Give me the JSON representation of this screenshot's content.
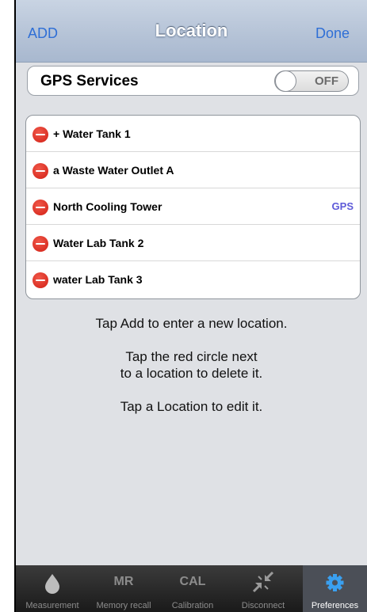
{
  "nav": {
    "left": "ADD",
    "title": "Location",
    "right": "Done"
  },
  "gps": {
    "label": "GPS Services",
    "toggle": "OFF"
  },
  "locations": [
    {
      "name": "+ Water Tank 1",
      "badge": ""
    },
    {
      "name": "a Waste Water Outlet A",
      "badge": ""
    },
    {
      "name": "North Cooling Tower",
      "badge": "GPS"
    },
    {
      "name": "Water Lab Tank 2",
      "badge": ""
    },
    {
      "name": "water Lab Tank 3",
      "badge": ""
    }
  ],
  "instructions": {
    "line1": "Tap Add to enter a new location.",
    "line2a": "Tap the red circle next",
    "line2b": "to a location to delete it.",
    "line3": "Tap a Location to edit it."
  },
  "tabs": [
    {
      "label": "Measurement",
      "icon": "drop-icon",
      "icon_text": ""
    },
    {
      "label": "Memory recall",
      "icon": "mr-icon",
      "icon_text": "MR"
    },
    {
      "label": "Calibration",
      "icon": "cal-icon",
      "icon_text": "CAL"
    },
    {
      "label": "Disconnect",
      "icon": "disconnect-icon",
      "icon_text": ""
    },
    {
      "label": "Preferences",
      "icon": "gear-icon",
      "icon_text": "",
      "active": true
    }
  ],
  "colors": {
    "accent": "#2f6fd6",
    "delete": "#d21f14",
    "gps_badge": "#5e5ad8",
    "active_tab_icon": "#3aa0f0"
  }
}
